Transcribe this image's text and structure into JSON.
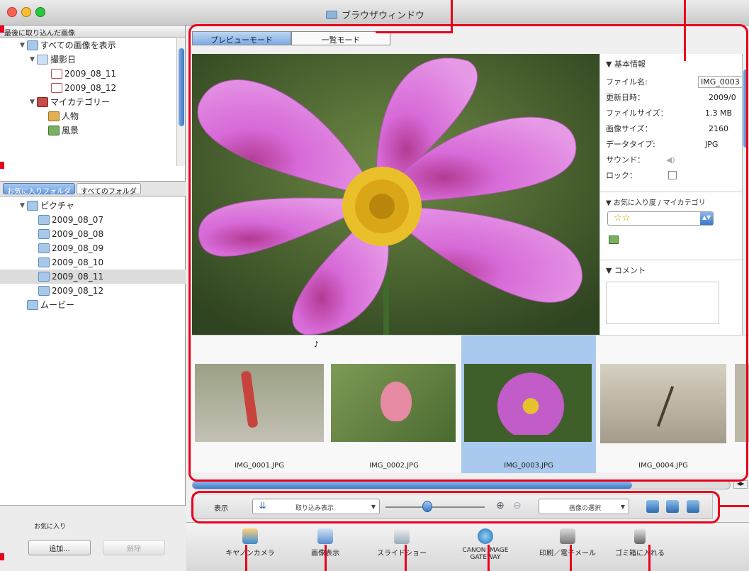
{
  "window": {
    "title": "ブラウザウィンドウ"
  },
  "left": {
    "header": "最後に取り込んだ画像",
    "tree": [
      {
        "label": "すべての画像を表示"
      },
      {
        "label": "撮影日"
      },
      {
        "label": "2009_08_11"
      },
      {
        "label": "2009_08_12"
      },
      {
        "label": "マイカテゴリー"
      },
      {
        "label": "人物"
      },
      {
        "label": "風景"
      }
    ],
    "tabs": [
      "お気に入りフォルダ",
      "すべてのフォルダ"
    ],
    "folders": [
      {
        "label": "ピクチャ"
      },
      {
        "label": "2009_08_07"
      },
      {
        "label": "2009_08_08"
      },
      {
        "label": "2009_08_09"
      },
      {
        "label": "2009_08_10"
      },
      {
        "label": "2009_08_11"
      },
      {
        "label": "2009_08_12"
      },
      {
        "label": "ムービー"
      }
    ],
    "favorites": {
      "label": "お気に入り",
      "add": "追加...",
      "remove": "解除"
    }
  },
  "modes": [
    "プレビューモード",
    "一覧モード"
  ],
  "info": {
    "section": "基本情報",
    "rows": [
      {
        "label": "ファイル名:",
        "value": "IMG_0003"
      },
      {
        "label": "更新日時：",
        "value": "2009/0"
      },
      {
        "label": "ファイルサイズ：",
        "value": "1.3 MB"
      },
      {
        "label": "画像サイズ：",
        "value": "2160"
      },
      {
        "label": "データタイプ:",
        "value": "JPG"
      },
      {
        "label": "サウンド：",
        "value": ""
      },
      {
        "label": "ロック：",
        "value": ""
      }
    ],
    "rating_header": "お気に入り度 / マイカテゴリ",
    "rating_value": "☆☆",
    "comment_header": "コメント"
  },
  "thumbs": [
    {
      "label": "IMG_0001.JPG",
      "bg": "#b07d78"
    },
    {
      "label": "IMG_0002.JPG",
      "bg": "#7e9a55"
    },
    {
      "label": "IMG_0003.JPG",
      "bg": "#c05cc8"
    },
    {
      "label": "IMG_0004.JPG",
      "bg": "#c8c1b2"
    }
  ],
  "toolbar": {
    "show_label": "表示",
    "filter": "取り込み表示",
    "select": "画像の選択"
  },
  "bottom": [
    {
      "label": "キヤノンカメラ"
    },
    {
      "label": "画像表示"
    },
    {
      "label": "スライドショー"
    },
    {
      "label": "CANON IMAGE GATEWAY"
    },
    {
      "label": "印刷／電子メール"
    },
    {
      "label": "ゴミ箱に入れる"
    }
  ],
  "colors": {
    "annotation": "#e8001c",
    "selection": "#a9c9ee"
  }
}
